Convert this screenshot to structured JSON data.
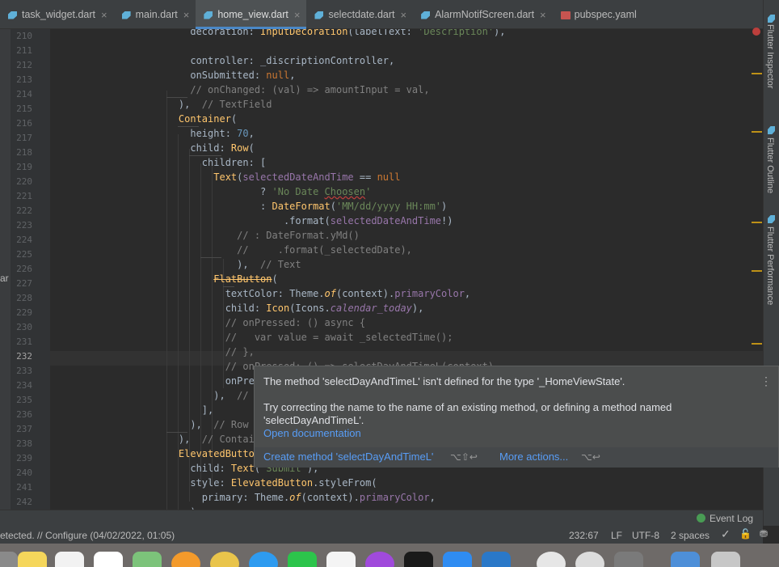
{
  "tabs": [
    {
      "label": "task_widget.dart",
      "type": "dart",
      "active": false
    },
    {
      "label": "main.dart",
      "type": "dart",
      "active": false
    },
    {
      "label": "home_view.dart",
      "type": "dart",
      "active": true
    },
    {
      "label": "selectdate.dart",
      "type": "dart",
      "active": false
    },
    {
      "label": "AlarmNotifScreen.dart",
      "type": "dart",
      "active": false
    },
    {
      "label": "pubspec.yaml",
      "type": "yaml",
      "active": false
    }
  ],
  "close_glyph": "×",
  "editor": {
    "current_line": "232",
    "line_numbers": [
      "210",
      "211",
      "212",
      "213",
      "214",
      "215",
      "216",
      "217",
      "218",
      "219",
      "220",
      "221",
      "222",
      "223",
      "224",
      "225",
      "226",
      "227",
      "228",
      "229",
      "230",
      "231",
      "232",
      "233",
      "234",
      "235",
      "236",
      "237",
      "238",
      "239",
      "240",
      "241",
      "242"
    ]
  },
  "popup": {
    "title": "The method 'selectDayAndTimeL' isn't defined for the type '_HomeViewState'.",
    "body_line1": "Try correcting the name to the name of an existing method, or defining a method named",
    "body_line2": "'selectDayAndTimeL'.",
    "open_doc": "Open documentation",
    "create_method": "Create method 'selectDayAndTimeL'",
    "create_shortcut": "⌥⇧↩",
    "more_actions": "More actions...",
    "more_shortcut": "⌥↩",
    "menu_glyph": "⋮"
  },
  "right_panel": [
    "Flutter Inspector",
    "Flutter Outline",
    "Flutter Performance"
  ],
  "status": {
    "event_log": "Event Log",
    "message": "etected. // Configure (04/02/2022, 01:05)",
    "position": "232:67",
    "line_sep": "LF",
    "encoding": "UTF-8",
    "indent": "2 spaces",
    "left_gutter_text": "ar"
  },
  "colors": {
    "accent": "#4a88c7",
    "link": "#589df6",
    "error": "#bc3f3c",
    "warning": "#be9117"
  }
}
